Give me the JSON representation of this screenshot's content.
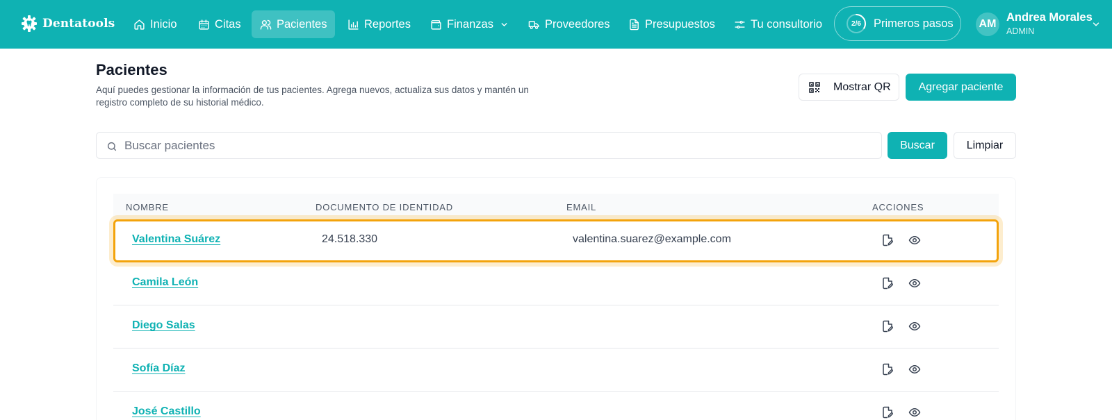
{
  "brand": {
    "name": "Dentatools"
  },
  "nav": {
    "items": [
      {
        "label": "Inicio",
        "icon": "home-icon"
      },
      {
        "label": "Citas",
        "icon": "calendar-icon"
      },
      {
        "label": "Pacientes",
        "icon": "users-icon",
        "active": true
      },
      {
        "label": "Reportes",
        "icon": "bar-chart-icon"
      },
      {
        "label": "Finanzas",
        "icon": "wallet-icon"
      },
      {
        "label": "Proveedores",
        "icon": "truck-icon"
      },
      {
        "label": "Presupuestos",
        "icon": "document-icon"
      },
      {
        "label": "Tu consultorio",
        "icon": "settings-sliders-icon"
      }
    ],
    "onboarding": {
      "progress": "2/6",
      "progress_fraction": 0.333,
      "label": "Primeros pasos"
    },
    "user": {
      "initials": "AM",
      "name": "Andrea Morales",
      "role": "ADMIN"
    }
  },
  "header": {
    "title": "Pacientes",
    "description": "Aquí puedes gestionar la información de tus pacientes. Agrega nuevos, actualiza sus datos y mantén un registro completo de su historial médico.",
    "qr_label": "Mostrar QR",
    "add_label": "Agregar paciente"
  },
  "search": {
    "placeholder": "Buscar pacientes",
    "search_label": "Buscar",
    "clear_label": "Limpiar"
  },
  "table": {
    "columns": [
      "NOMBRE",
      "DOCUMENTO DE IDENTIDAD",
      "EMAIL",
      "ACCIONES"
    ],
    "rows": [
      {
        "name": "Valentina Suárez",
        "document": "24.518.330",
        "email": "valentina.suarez@example.com"
      },
      {
        "name": "Camila León",
        "document": "",
        "email": ""
      },
      {
        "name": "Diego Salas",
        "document": "",
        "email": ""
      },
      {
        "name": "Sofía Díaz",
        "document": "",
        "email": ""
      },
      {
        "name": "José Castillo",
        "document": "",
        "email": ""
      }
    ]
  },
  "colors": {
    "brand": "#0fb2b3",
    "highlight": "#f3a30b"
  }
}
